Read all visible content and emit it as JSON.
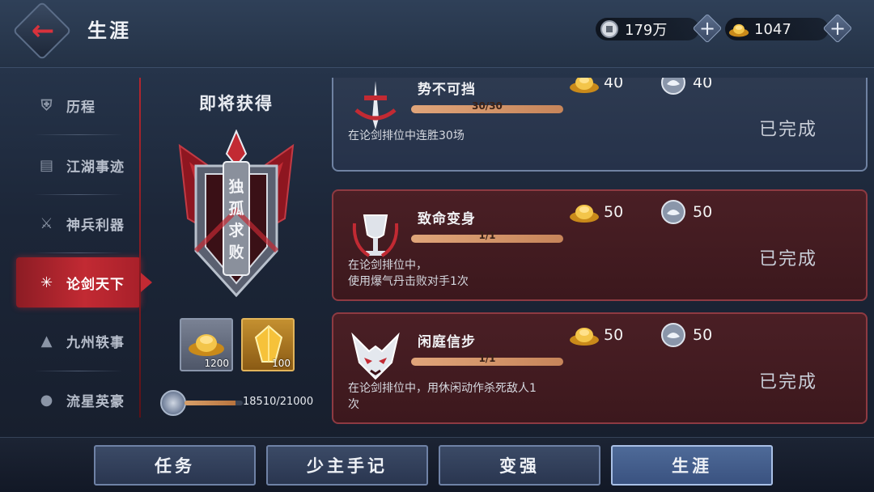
{
  "header": {
    "title": "生涯",
    "currencies": [
      {
        "icon": "silver-coin-icon",
        "value": "179万"
      },
      {
        "icon": "gold-ingot-icon",
        "value": "1047"
      }
    ]
  },
  "sidebar": {
    "items": [
      {
        "icon": "shield-icon",
        "label": "历程"
      },
      {
        "icon": "scroll-icon",
        "label": "江湖事迹"
      },
      {
        "icon": "crossed-swords-icon",
        "label": "神兵利器"
      },
      {
        "icon": "sparkle-icon",
        "label": "论剑天下",
        "active": true
      },
      {
        "icon": "mountain-icon",
        "label": "九州轶事"
      },
      {
        "icon": "hero-icon",
        "label": "流星英豪"
      }
    ]
  },
  "reward_panel": {
    "title": "即将获得",
    "badge_text": [
      "独",
      "孤",
      "求",
      "败"
    ],
    "items": [
      {
        "icon": "gold-ingot-icon",
        "count": "1200"
      },
      {
        "icon": "gem-icon",
        "count": "100"
      }
    ],
    "progress": {
      "text": "18510/21000",
      "fraction": 0.881
    }
  },
  "achievements": [
    {
      "name": "势不可挡",
      "icon": "sword-emblem-icon",
      "progress_text": "30/30",
      "progress_fraction": 1.0,
      "description": [
        "在论剑排位中连胜30场"
      ],
      "rewards": [
        {
          "icon": "gold-ingot-icon",
          "value": "40"
        },
        {
          "icon": "lotus-token-icon",
          "value": "40"
        }
      ],
      "status": "已完成",
      "theme": "blue"
    },
    {
      "name": "致命变身",
      "icon": "chalice-icon",
      "progress_text": "1/1",
      "progress_fraction": 1.0,
      "description": [
        "在论剑排位中，",
        "使用爆气丹击败对手1次"
      ],
      "rewards": [
        {
          "icon": "gold-ingot-icon",
          "value": "50"
        },
        {
          "icon": "lotus-token-icon",
          "value": "50"
        }
      ],
      "status": "已完成",
      "theme": "red"
    },
    {
      "name": "闲庭信步",
      "icon": "mask-icon",
      "progress_text": "1/1",
      "progress_fraction": 1.0,
      "description": [
        "在论剑排位中，用休闲动作杀死敌人1",
        "次"
      ],
      "rewards": [
        {
          "icon": "gold-ingot-icon",
          "value": "50"
        },
        {
          "icon": "lotus-token-icon",
          "value": "50"
        }
      ],
      "status": "已完成",
      "theme": "red"
    }
  ],
  "bottom_nav": [
    {
      "label": "任务"
    },
    {
      "label": "少主手记"
    },
    {
      "label": "变强"
    },
    {
      "label": "生涯",
      "active": true
    }
  ],
  "colors": {
    "accent_red": "#c22a33",
    "gold": "#e8b83a",
    "bar": "#d89a6a"
  }
}
